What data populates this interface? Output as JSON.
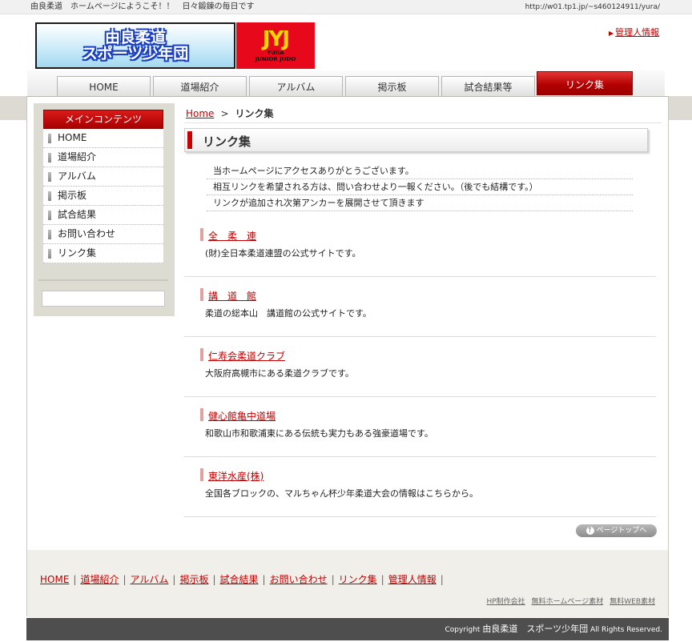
{
  "topbar": {
    "welcome": "由良柔道　ホームページにようこそ！！　日々鍛錬の毎日です",
    "url": "http://w01.tp1.jp/~s460124911/yura/"
  },
  "header": {
    "logo_text_line1": "由良柔道",
    "logo_text_line2": "スポーツ少年団",
    "emblem_mark": "JYJ",
    "emblem_line1": "YURA",
    "emblem_line2": "JUNIOR JUDO",
    "admin_link": "管理人情報"
  },
  "tabs": [
    {
      "label": "HOME",
      "active": false
    },
    {
      "label": "道場紹介",
      "active": false
    },
    {
      "label": "アルバム",
      "active": false
    },
    {
      "label": "掲示板",
      "active": false
    },
    {
      "label": "試合結果等",
      "active": false
    },
    {
      "label": "リンク集",
      "active": true
    }
  ],
  "sidebar": {
    "title": "メインコンテンツ",
    "items": [
      {
        "label": "HOME"
      },
      {
        "label": "道場紹介"
      },
      {
        "label": "アルバム"
      },
      {
        "label": "掲示板"
      },
      {
        "label": "試合結果"
      },
      {
        "label": "お問い合わせ"
      },
      {
        "label": "リンク集"
      }
    ]
  },
  "breadcrumb": {
    "home": "Home",
    "separator": ">",
    "current": "リンク集"
  },
  "page": {
    "heading": "リンク集",
    "intro": [
      "当ホームページにアクセスありがとうございます。",
      "相互リンクを希望される方は、問い合わせより一報ください。（後でも結構です。）",
      "リンクが追加され次第アンカーを展開させて頂きます"
    ],
    "links": [
      {
        "title": "全　柔　連",
        "desc": "(財)全日本柔道連盟の公式サイトです。"
      },
      {
        "title": "講　道　館",
        "desc": "柔道の総本山　講道館の公式サイトです。"
      },
      {
        "title": "仁寿会柔道クラブ",
        "desc": "大阪府高槻市にある柔道クラブです。"
      },
      {
        "title": "健心館亀中道場",
        "desc": "和歌山市和歌浦東にある伝統も実力もある強豪道場です。"
      },
      {
        "title": "東洋水産(株)",
        "desc": "全国各ブロックの、マルちゃん杯少年柔道大会の情報はこちらから。"
      }
    ],
    "pagetop_label": "ページトップへ",
    "pagetop_glyph": "↑"
  },
  "footer": {
    "links": [
      "HOME",
      "道場紹介",
      "アルバム",
      "掲示板",
      "試合結果",
      "お問い合わせ",
      "リンク集",
      "管理人情報"
    ],
    "sub_links": [
      "HP制作会社",
      "無料ホームページ素材",
      "無料WEB素材"
    ],
    "copyright_prefix": "Copyright ",
    "copyright_name": "由良柔道　スポーツ少年団",
    "copyright_suffix": " All Rights Reserved."
  },
  "colors": {
    "accent_red": "#c00000",
    "tab_active": "#b30000",
    "footer_bar": "#4e4e4e"
  },
  "icons": {
    "admin_arrow": "triangle-right-icon",
    "sidebar_bullet": "bar-icon",
    "pagetop": "up-arrow-circle-icon"
  }
}
